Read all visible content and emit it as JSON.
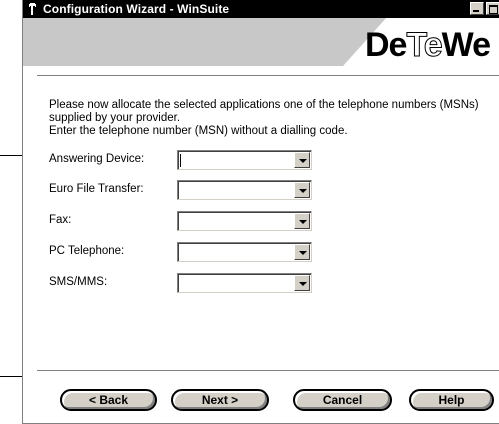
{
  "window": {
    "title": "Configuration Wizard - WinSuite",
    "controls": [
      "minimize",
      "maximize"
    ]
  },
  "banner": {
    "logo_prefix": "De",
    "logo_mid": "Te",
    "logo_suffix": "We"
  },
  "instructions": {
    "line1": "Please now allocate the selected applications one of the telephone numbers (MSNs) supplied by your provider.",
    "line2": "Enter the telephone number (MSN) without a dialling code."
  },
  "fields": [
    {
      "label": "Answering Device:",
      "value": "",
      "focused": true
    },
    {
      "label": "Euro File Transfer:",
      "value": ""
    },
    {
      "label": "Fax:",
      "value": ""
    },
    {
      "label": "PC Telephone:",
      "value": ""
    },
    {
      "label": "SMS/MMS:",
      "value": ""
    }
  ],
  "buttons": {
    "back": "< Back",
    "next": "Next >",
    "cancel": "Cancel",
    "help": "Help"
  },
  "colors": {
    "titlebar": "#000000",
    "banner": "#c8c8c8",
    "button_face": "#d4d0c8"
  }
}
